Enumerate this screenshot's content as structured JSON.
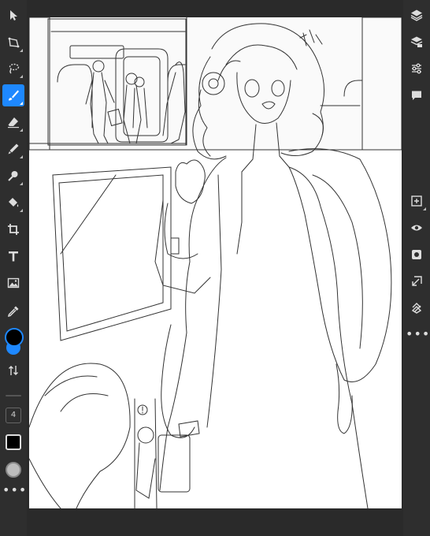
{
  "app": {
    "theme_accent": "#1e88ff",
    "background": "#2b2b2b"
  },
  "left_toolbar": {
    "tools": [
      {
        "name": "select-tool",
        "icon": "arrow-cursor-icon"
      },
      {
        "name": "transform-tool",
        "icon": "transform-icon"
      },
      {
        "name": "lasso-tool",
        "icon": "lasso-icon"
      },
      {
        "name": "brush-tool",
        "icon": "brush-icon",
        "active": true
      },
      {
        "name": "eraser-tool",
        "icon": "eraser-icon"
      },
      {
        "name": "blend-tool",
        "icon": "blend-icon"
      },
      {
        "name": "smudge-tool",
        "icon": "smudge-icon"
      },
      {
        "name": "fill-tool",
        "icon": "paint-bucket-icon"
      },
      {
        "name": "crop-tool",
        "icon": "crop-icon"
      },
      {
        "name": "text-tool",
        "icon": "text-icon"
      },
      {
        "name": "image-tool",
        "icon": "image-icon"
      },
      {
        "name": "eyedropper-tool",
        "icon": "eyedropper-icon"
      }
    ],
    "primary_color": "#000000",
    "secondary_color": "#1e88ff",
    "brush_size": "4",
    "stroke_color": "#000000"
  },
  "right_toolbar": {
    "tools": [
      {
        "name": "layers",
        "icon": "layers-icon"
      },
      {
        "name": "add-layer",
        "icon": "layer-stack-icon"
      },
      {
        "name": "adjustments",
        "icon": "sliders-icon"
      },
      {
        "name": "comments",
        "icon": "chat-icon"
      },
      {
        "name": "new-layer",
        "icon": "plus-square-icon"
      },
      {
        "name": "visibility",
        "icon": "eye-icon"
      },
      {
        "name": "mask",
        "icon": "mask-icon"
      },
      {
        "name": "merge-down",
        "icon": "merge-down-icon"
      },
      {
        "name": "clear-layer",
        "icon": "eraser-layer-icon"
      }
    ]
  }
}
